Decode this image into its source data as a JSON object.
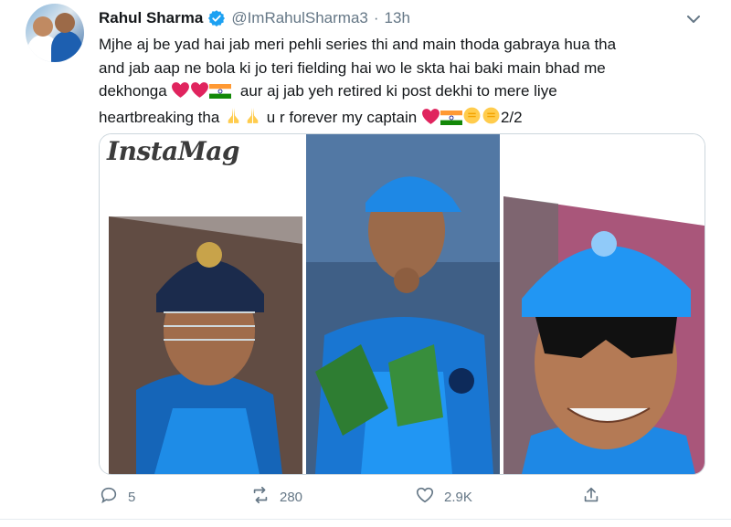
{
  "author": {
    "name": "Rahul Sharma",
    "handle": "@ImRahulSharma3",
    "separator": "·",
    "time": "13h"
  },
  "tweet": {
    "line1": "Mjhe aj be yad hai jab meri pehli series thi and main thoda gabraya hua tha",
    "line2": "and jab aap ne bola ki jo teri fielding hai wo le skta hai baki main bhad me",
    "line3_text": "dekhonga",
    "line3_text2": "aur aj jab yeh retired ki post dekhi to mere liye",
    "line4_text": "heartbreaking tha",
    "line4_text2": "u r forever my captain",
    "line4_text3": "2/2"
  },
  "media": {
    "brand": "InstaMag"
  },
  "actions": {
    "replies": "5",
    "retweets": "280",
    "likes": "2.9K"
  },
  "colors": {
    "accent": "#1da1f2",
    "muted": "#657786",
    "text": "#14171a",
    "heart": "#e0245e"
  }
}
